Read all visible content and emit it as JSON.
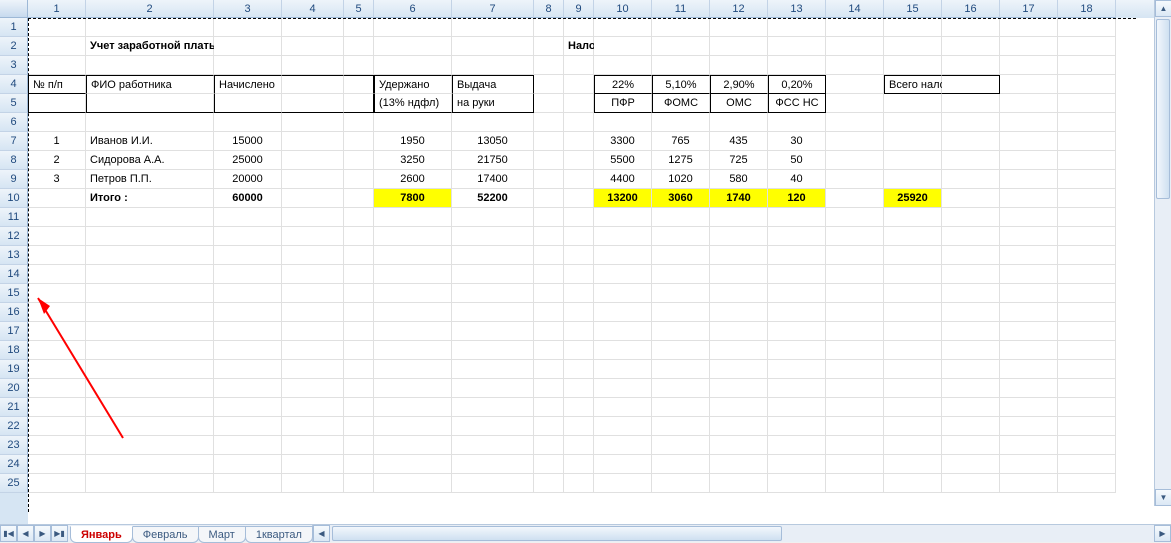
{
  "columns": [
    {
      "n": "1",
      "w": 58
    },
    {
      "n": "2",
      "w": 128
    },
    {
      "n": "3",
      "w": 68
    },
    {
      "n": "4",
      "w": 62
    },
    {
      "n": "5",
      "w": 30
    },
    {
      "n": "6",
      "w": 78
    },
    {
      "n": "7",
      "w": 82
    },
    {
      "n": "8",
      "w": 30
    },
    {
      "n": "9",
      "w": 30
    },
    {
      "n": "10",
      "w": 58
    },
    {
      "n": "11",
      "w": 58
    },
    {
      "n": "12",
      "w": 58
    },
    {
      "n": "13",
      "w": 58
    },
    {
      "n": "14",
      "w": 58
    },
    {
      "n": "15",
      "w": 58
    },
    {
      "n": "16",
      "w": 58
    },
    {
      "n": "17",
      "w": 58
    },
    {
      "n": "18",
      "w": 58
    }
  ],
  "row_count": 25,
  "titles": {
    "main": "Учет заработной платы и отчислений налогов",
    "taxes": "Налоги с ФОТ:"
  },
  "headers": {
    "num": "№ п/п",
    "fio": "ФИО работника",
    "accrued": "Начислено",
    "withheld": "Удержано",
    "withheld2": "(13% ндфл)",
    "payout": "Выдача",
    "payout2": "на руки",
    "rate_pfr": "22%",
    "rate_foms": "5,10%",
    "rate_oms": "2,90%",
    "rate_fss": "0,20%",
    "pfr": "ПФР",
    "foms": "ФОМС",
    "oms": "ОМС",
    "fss": "ФСС НС",
    "total_tax": "Всего налогов"
  },
  "rows": [
    {
      "n": "1",
      "fio": "Иванов И.И.",
      "acc": "15000",
      "wh": "1950",
      "pay": "13050",
      "pfr": "3300",
      "foms": "765",
      "oms": "435",
      "fss": "30"
    },
    {
      "n": "2",
      "fio": "Сидорова А.А.",
      "acc": "25000",
      "wh": "3250",
      "pay": "21750",
      "pfr": "5500",
      "foms": "1275",
      "oms": "725",
      "fss": "50"
    },
    {
      "n": "3",
      "fio": "Петров П.П.",
      "acc": "20000",
      "wh": "2600",
      "pay": "17400",
      "pfr": "4400",
      "foms": "1020",
      "oms": "580",
      "fss": "40"
    }
  ],
  "totals": {
    "label": "Итого :",
    "acc": "60000",
    "wh": "7800",
    "pay": "52200",
    "pfr": "13200",
    "foms": "3060",
    "oms": "1740",
    "fss": "120",
    "all": "25920"
  },
  "sheets": {
    "active": "Январь",
    "others": [
      "Февраль",
      "Март",
      "1квартал"
    ]
  }
}
